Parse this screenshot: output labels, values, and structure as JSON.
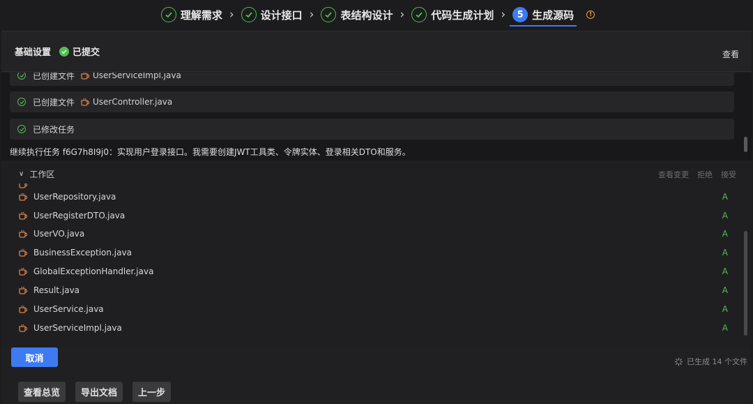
{
  "stepper": {
    "steps": [
      {
        "label": "理解需求",
        "state": "done"
      },
      {
        "label": "设计接口",
        "state": "done"
      },
      {
        "label": "表结构设计",
        "state": "done"
      },
      {
        "label": "代码生成计划",
        "state": "done"
      },
      {
        "label": "生成源码",
        "state": "active",
        "number": "5"
      }
    ],
    "info_icon": "info-icon"
  },
  "panel": {
    "title": "基础设置",
    "status": "已提交",
    "view_label": "查看"
  },
  "log": {
    "items": [
      {
        "text": "已创建文件",
        "file": "UserServiceImpl.java"
      },
      {
        "text": "已创建文件",
        "file": "UserController.java"
      },
      {
        "text": "已修改任务",
        "file": ""
      }
    ],
    "task_line": "继续执行任务 f6G7h8I9j0：实现用户登录接口。我需要创建JWT工具类、令牌实体、登录相关DTO和服务。"
  },
  "workspace": {
    "title": "工作区",
    "actions": [
      "查看变更",
      "拒绝",
      "接受"
    ],
    "files": [
      {
        "name": "UserRepository.java",
        "status": "A"
      },
      {
        "name": "UserRegisterDTO.java",
        "status": "A"
      },
      {
        "name": "UserVO.java",
        "status": "A"
      },
      {
        "name": "BusinessException.java",
        "status": "A"
      },
      {
        "name": "GlobalExceptionHandler.java",
        "status": "A"
      },
      {
        "name": "Result.java",
        "status": "A"
      },
      {
        "name": "UserService.java",
        "status": "A"
      },
      {
        "name": "UserServiceImpl.java",
        "status": "A"
      }
    ]
  },
  "actions": {
    "cancel": "取消",
    "generated": "已生成 14 个文件"
  },
  "footer": {
    "overview": "查看总览",
    "export": "导出文档",
    "prev": "上一步"
  },
  "colors": {
    "accent": "#3d7bf2",
    "success": "#4fbf4f",
    "java_icon": "#d9824a",
    "warning": "#e6a23c"
  }
}
